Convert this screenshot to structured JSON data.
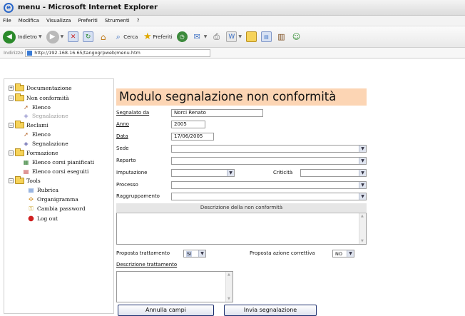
{
  "window": {
    "title": "menu - Microsoft Internet Explorer"
  },
  "menubar": [
    "File",
    "Modifica",
    "Visualizza",
    "Preferiti",
    "Strumenti",
    "?"
  ],
  "toolbar": {
    "back": "Indietro",
    "search": "Cerca",
    "favorites": "Preferiti"
  },
  "address": {
    "label": "Indirizzo",
    "url": "http://192.168.16.65/tangogrpweb/menu.htm"
  },
  "sidebar": {
    "documentazione": "Documentazione",
    "nonconformita": "Non conformità",
    "nc_elenco": "Elenco",
    "nc_segnalazione": "Segnalazione",
    "reclami": "Reclami",
    "rec_elenco": "Elenco",
    "rec_segnalazione": "Segnalazione",
    "formazione": "Formazione",
    "corsi_pianificati": "Elenco corsi pianificati",
    "corsi_eseguiti": "Elenco corsi eseguiti",
    "tools": "Tools",
    "rubrica": "Rubrica",
    "organigramma": "Organigramma",
    "cambia_password": "Cambia password",
    "logout": "Log out"
  },
  "form": {
    "title": "Modulo segnalazione non conformità",
    "segnalato_da_label": "Segnalato da",
    "segnalato_da_value": "Norci Renato",
    "anno_label": "Anno",
    "anno_value": "2005",
    "data_label": "Data",
    "data_value": "17/06/2005",
    "sede_label": "Sede",
    "reparto_label": "Reparto",
    "imputazione_label": "Imputazione",
    "criticita_label": "Criticità",
    "processo_label": "Processo",
    "raggruppamento_label": "Raggruppamento",
    "descrizione_header": "Descrizione della non conformità",
    "proposta_trattamento_label": "Proposta trattamento",
    "proposta_trattamento_value": "SI",
    "proposta_azione_label": "Proposta azione correttiva",
    "proposta_azione_value": "NO",
    "descrizione_trattamento_label": "Descrizione trattamento",
    "annulla_label": "Annulla campi",
    "invia_label": "Invia segnalazione"
  }
}
